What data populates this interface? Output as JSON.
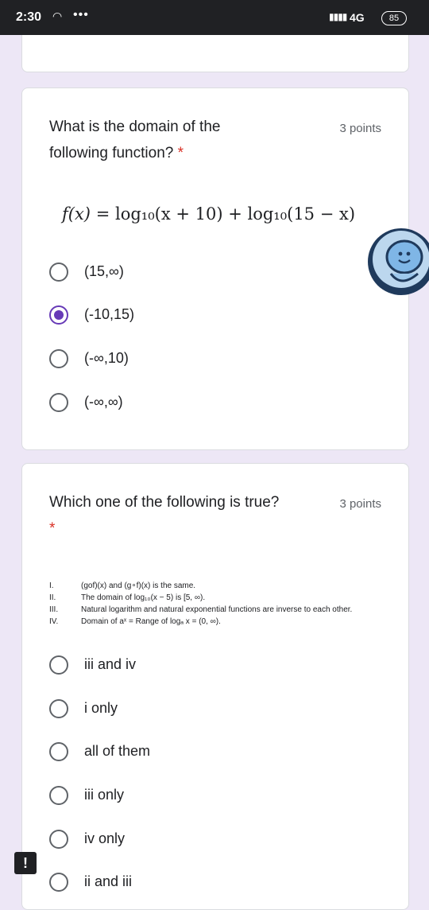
{
  "status_bar": {
    "time": "2:30",
    "network": "4G",
    "battery": "85"
  },
  "question1": {
    "title": "What is the domain of the following function?",
    "required_mark": "*",
    "points": "3 points",
    "formula": {
      "lhs": "f(x)",
      "equals": "=",
      "rhs": "log₁₀(x + 10) + log₁₀(15 − x)"
    },
    "options": [
      {
        "label": "(15,∞)",
        "selected": false
      },
      {
        "label": "(-10,15)",
        "selected": true
      },
      {
        "label": "(-∞,10)",
        "selected": false
      },
      {
        "label": "(-∞,∞)",
        "selected": false
      }
    ]
  },
  "question2": {
    "title": "Which one of the following is true?",
    "required_mark": "*",
    "points": "3 points",
    "statements": [
      {
        "num": "I.",
        "text": "(gof)(x) and (g∘f)(x) is the same."
      },
      {
        "num": "II.",
        "text": "The domain of log₁₀(x − 5) is [5, ∞)."
      },
      {
        "num": "III.",
        "text": "Natural logarithm and natural exponential functions are inverse to each other."
      },
      {
        "num": "IV.",
        "text": "Domain of aˣ = Range of logₐ x = (0, ∞)."
      }
    ],
    "options": [
      {
        "label": "iii and iv",
        "selected": false
      },
      {
        "label": "i only",
        "selected": false
      },
      {
        "label": "all of them",
        "selected": false
      },
      {
        "label": "iii only",
        "selected": false
      },
      {
        "label": "iv only",
        "selected": false
      },
      {
        "label": "ii and iii",
        "selected": false
      }
    ]
  },
  "colors": {
    "accent": "#673ab7",
    "background": "#ede7f6",
    "required": "#d93025"
  },
  "icons": {
    "wifi": "wifi-icon",
    "avatar": "assistant-avatar-icon",
    "feedback": "feedback-icon"
  }
}
